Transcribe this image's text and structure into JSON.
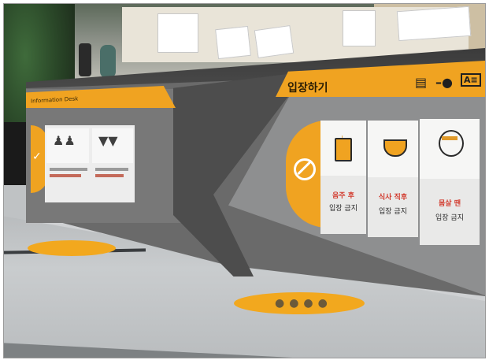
{
  "counter": {
    "left_banner": "Information Desk",
    "right_banner": "입장하기",
    "banner_icons": [
      "document-icon",
      "key-icon",
      "id-card-icon"
    ]
  },
  "restrictions": [
    {
      "icon": "beer-icon",
      "line1": "음주 후",
      "line2": "입장 금지"
    },
    {
      "icon": "rice-bowl-icon",
      "line1": "식사 직후",
      "line2": "입장 금지"
    },
    {
      "icon": "sick-person-icon",
      "line1": "몸살 땐",
      "line2": "입장 금지"
    }
  ],
  "colors": {
    "accent": "#f0a321",
    "red_text": "#d23b2e"
  }
}
